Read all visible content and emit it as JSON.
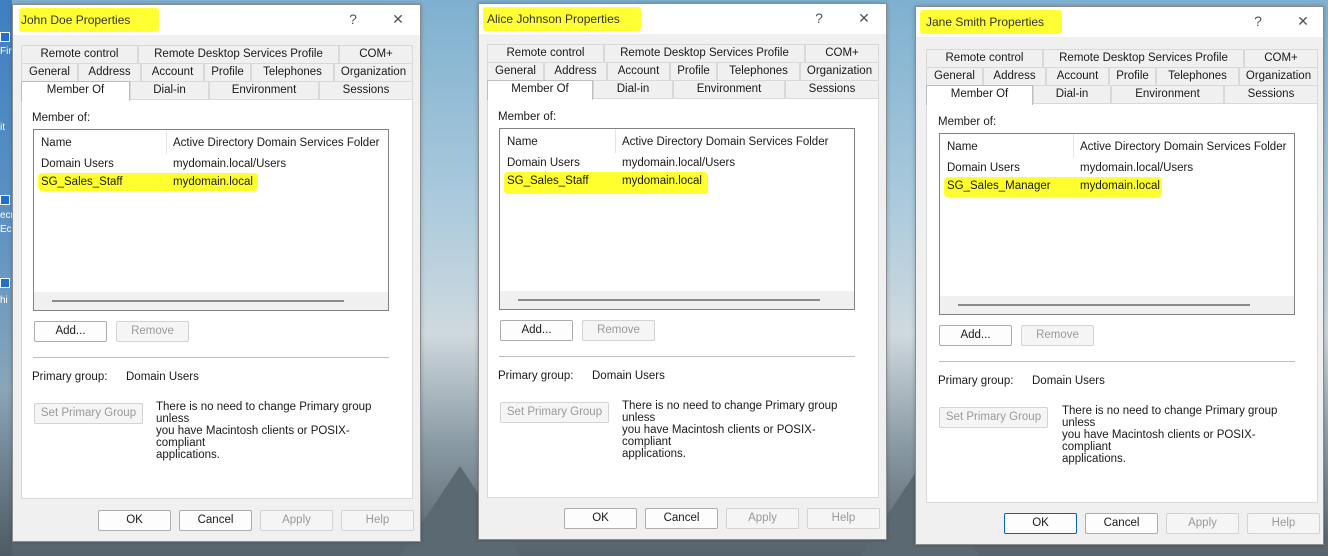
{
  "desktop": {
    "side_texts": [
      "Fir",
      "it",
      "ecr",
      "Ec",
      "hi"
    ]
  },
  "tabs_row1": [
    "Remote control",
    "Remote Desktop Services Profile",
    "COM+"
  ],
  "tabs_row2": [
    "General",
    "Address",
    "Account",
    "Profile",
    "Telephones",
    "Organization"
  ],
  "tabs_row3": [
    "Member Of",
    "Dial-in",
    "Environment",
    "Sessions"
  ],
  "member_of_label": "Member of:",
  "columns": [
    "Name",
    "Active Directory Domain Services Folder"
  ],
  "buttons": {
    "add": "Add...",
    "remove": "Remove",
    "set_primary": "Set Primary Group",
    "ok": "OK",
    "cancel": "Cancel",
    "apply": "Apply",
    "help": "Help"
  },
  "primary_group_label": "Primary group:",
  "primary_group_value": "Domain Users",
  "note_lines": [
    "There is no need to change Primary group unless",
    "you have Macintosh clients or POSIX-compliant",
    "applications."
  ],
  "titlebar_help": "?",
  "titlebar_close": "✕",
  "dialogs": [
    {
      "title": "John Doe Properties",
      "rows": [
        {
          "name": "Domain Users",
          "folder": "mydomain.local/Users",
          "highlighted": false
        },
        {
          "name": "SG_Sales_Staff",
          "folder": "mydomain.local",
          "highlighted": true
        }
      ]
    },
    {
      "title": "Alice Johnson Properties",
      "rows": [
        {
          "name": "Domain Users",
          "folder": "mydomain.local/Users",
          "highlighted": false
        },
        {
          "name": "SG_Sales_Staff",
          "folder": "mydomain.local",
          "highlighted": true
        }
      ]
    },
    {
      "title": "Jane Smith Properties",
      "rows": [
        {
          "name": "Domain Users",
          "folder": "mydomain.local/Users",
          "highlighted": false
        },
        {
          "name": "SG_Sales_Manager",
          "folder": "mydomain.local",
          "highlighted": true
        }
      ]
    }
  ],
  "colors": {
    "highlight": "#ffff33",
    "dialog_bg": "#f0f0f0"
  }
}
